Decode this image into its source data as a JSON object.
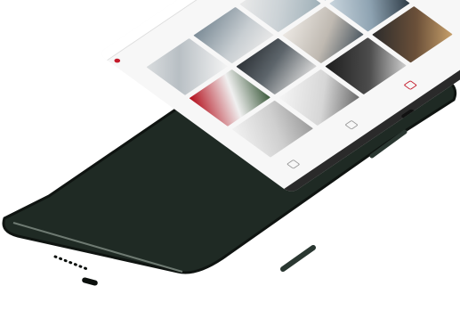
{
  "scene": {
    "phone_color": "#1f2a24",
    "screen_background": "#f7f7f7",
    "accent_color": "#c41a2a",
    "icons": [
      "camera-icon",
      "bookmark-icon",
      "settings-icon"
    ]
  },
  "screen": {
    "topbar_text": "",
    "nav_items": [],
    "heading": "",
    "tiles_count": 12
  }
}
